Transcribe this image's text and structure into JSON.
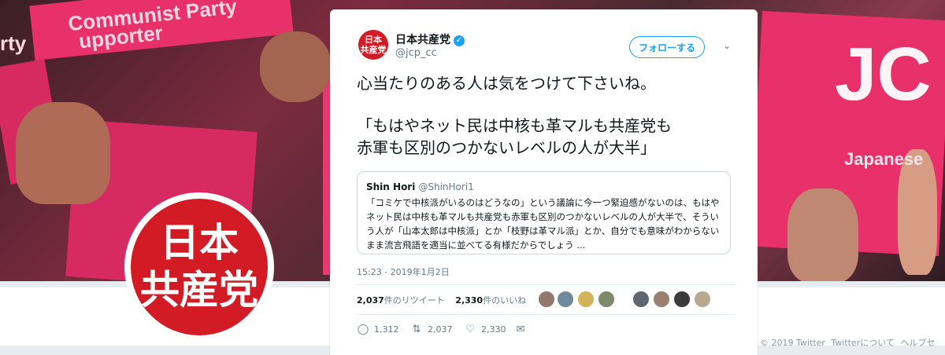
{
  "background": {
    "sign_text_1": "Communist Party",
    "sign_text_2": "upporter",
    "sign_text_3": "rty",
    "sign_text_jc": "JC",
    "sign_text_japanese": "Japanese",
    "profile_logo_line1": "日本",
    "profile_logo_line2": "共産党"
  },
  "tweet": {
    "avatar_line1": "日本",
    "avatar_line2": "共産党",
    "display_name": "日本共産党",
    "verified_icon": "verified-badge-icon",
    "handle": "@jcp_cc",
    "follow_label": "フォローする",
    "caret_icon": "chevron-down-icon",
    "text_line1": "心当たりのある人は気をつけて下さいね。",
    "text_line2": "「もはやネット民は中核も革マルも共産党も",
    "text_line3": "赤軍も区別のつかないレベルの人が大半」",
    "quote": {
      "name": "Shin Hori",
      "handle": "@ShinHori1",
      "text": "「コミケで中核派がいるのはどうなの」という議論に今一つ緊迫感がないのは、もはやネット民は中核も革マルも共産党も赤軍も区別のつかないレベルの人が大半で、そういう人が「山本太郎は中核派」とか「枝野は革マル派」とか、自分でも意味がわからないまま流言飛語を適当に並べてる有様だからでしょう ..."
    },
    "timestamp": "15:23 - 2019年1月2日",
    "retweets_count": "2,037",
    "retweets_label": "件のリツイート",
    "likes_count": "2,330",
    "likes_label": "件のいいね",
    "actions": {
      "reply_count": "1,312",
      "retweet_count": "2,037",
      "like_count": "2,330"
    }
  },
  "footer": {
    "copyright": "© 2019 Twitter",
    "about": "Twitterについて",
    "help": "ヘルプセ"
  },
  "colors": {
    "accent": "#1da1f2",
    "party_red": "#d31b25",
    "sign_pink": "#e8306a"
  }
}
